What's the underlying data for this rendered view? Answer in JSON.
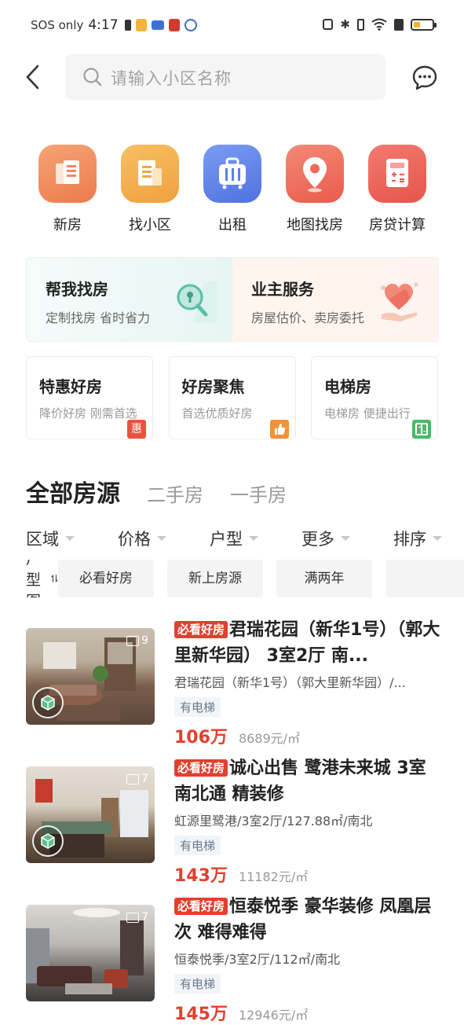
{
  "status_bar": {
    "carrier": "SOS only",
    "time": "4:17"
  },
  "search": {
    "placeholder": "请输入小区名称"
  },
  "quick_entries": [
    {
      "label": "新房",
      "icon": "new-house-icon",
      "color": "#f08a5d"
    },
    {
      "label": "找小区",
      "icon": "community-icon",
      "color": "#f3a64a"
    },
    {
      "label": "出租",
      "icon": "rent-icon",
      "color": "#5b7fe8"
    },
    {
      "label": "地图找房",
      "icon": "map-pin-icon",
      "color": "#ee6a5a"
    },
    {
      "label": "房贷计算",
      "icon": "calculator-icon",
      "color": "#ec5f57"
    }
  ],
  "services": [
    {
      "title": "帮我找房",
      "subtitle": "定制找房 省时省力"
    },
    {
      "title": "业主服务",
      "subtitle": "房屋估价、卖房委托"
    }
  ],
  "feature_cards": [
    {
      "title": "特惠好房",
      "subtitle": "降价好房 刚需首选",
      "badge": "惠",
      "badge_color": "#e8533f"
    },
    {
      "title": "好房聚焦",
      "subtitle": "首选优质好房",
      "badge": "👍",
      "badge_color": "#f0923a"
    },
    {
      "title": "电梯房",
      "subtitle": "电梯房 便捷出行",
      "badge": "▥",
      "badge_color": "#4cb86a"
    }
  ],
  "tabs": [
    {
      "label": "全部房源",
      "active": true
    },
    {
      "label": "二手房",
      "active": false
    },
    {
      "label": "一手房",
      "active": false
    }
  ],
  "filters": [
    "区域",
    "价格",
    "户型",
    "更多",
    "排序"
  ],
  "chips": {
    "layout_sort": "户型图",
    "items": [
      "必看好房",
      "新上房源",
      "满两年",
      ""
    ]
  },
  "listings": [
    {
      "tag": "必看好房",
      "title": "君瑞花园（新华1号）（郭大里新华园） 3室2厅 南...",
      "subtitle": "君瑞花园（新华1号）（郭大里新华园）/...",
      "elevator": "有电梯",
      "price": "106万",
      "unit_price": "8689元/㎡",
      "photo_count": "9",
      "has_vr": true
    },
    {
      "tag": "必看好房",
      "title": "诚心出售 鹭港未来城 3室 南北通 精装修",
      "subtitle": "虹源里鹭港/3室2厅/127.88㎡/南北",
      "elevator": "有电梯",
      "price": "143万",
      "unit_price": "11182元/㎡",
      "photo_count": "7",
      "has_vr": true
    },
    {
      "tag": "必看好房",
      "title": "恒泰悦季 豪华装修 凤凰层次 难得难得",
      "subtitle": "恒泰悦季/3室2厅/112㎡/南北",
      "elevator": "有电梯",
      "price": "145万",
      "unit_price": "12946元/㎡",
      "photo_count": "7",
      "has_vr": false
    }
  ]
}
